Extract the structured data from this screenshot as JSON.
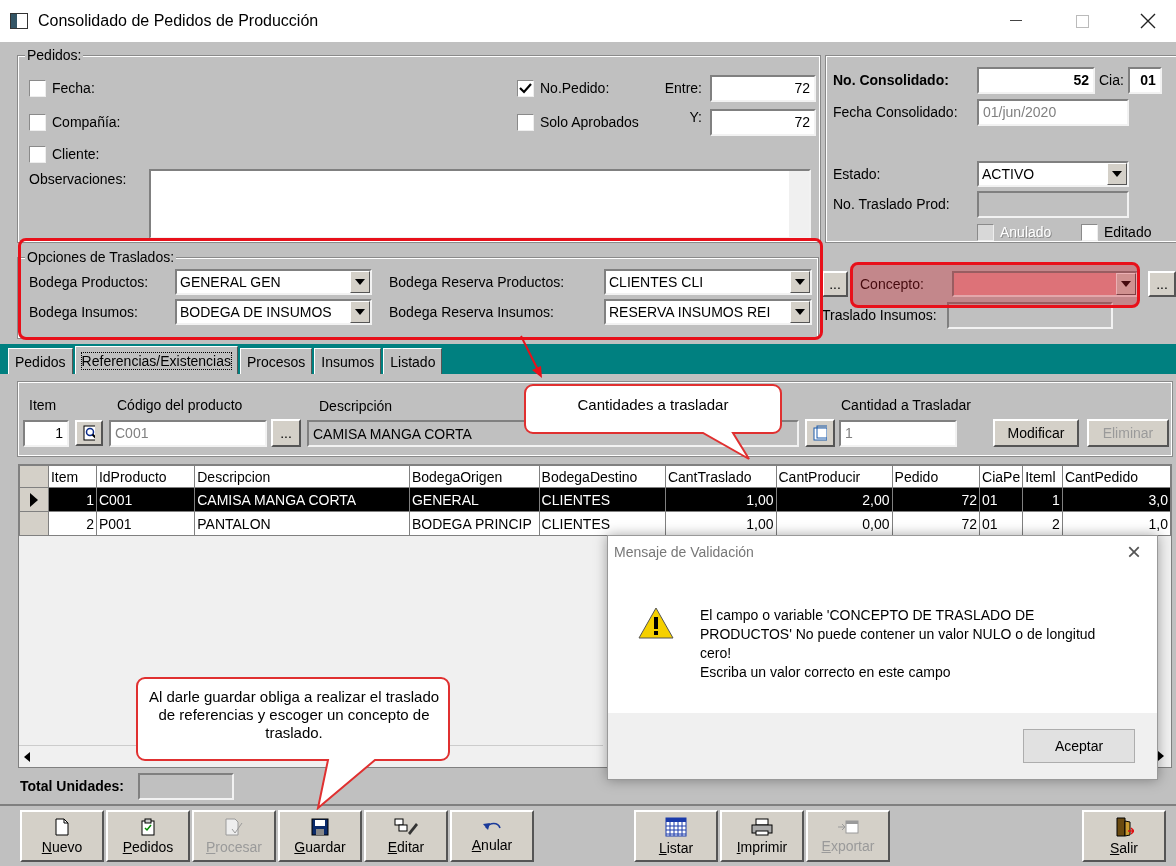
{
  "window": {
    "title": "Consolidado de Pedidos de Producción"
  },
  "pedidos": {
    "legend": "Pedidos:",
    "filters": [
      {
        "label": "Fecha:",
        "checked": false
      },
      {
        "label": "Compañía:",
        "checked": false
      },
      {
        "label": "Cliente:",
        "checked": false
      }
    ],
    "options": [
      {
        "label": "No.Pedido:",
        "checked": true
      },
      {
        "label": "Solo Aprobados",
        "checked": false
      }
    ],
    "range": [
      {
        "label": "Entre:",
        "value": "72"
      },
      {
        "label": "Y:",
        "value": "72"
      }
    ],
    "observaciones": {
      "label": "Observaciones:"
    }
  },
  "consolidado": {
    "number": {
      "label": "No. Consolidado:",
      "value": "52"
    },
    "cia": {
      "label": "Cia:",
      "value": "01"
    },
    "fecha": {
      "label": "Fecha Consolidado:",
      "value": "01/jun/2020"
    },
    "estado": {
      "label": "Estado:",
      "value": "ACTIVO"
    },
    "traslado_prod": {
      "label": "No. Traslado Prod:"
    },
    "flags": [
      {
        "label": "Anulado",
        "checked": false,
        "disabled": true
      },
      {
        "label": "Editado",
        "checked": false,
        "disabled": false
      }
    ]
  },
  "opciones": {
    "legend": "Opciones de Traslados:",
    "bodegas": [
      {
        "label": "Bodega Productos:",
        "value": "GENERAL GEN"
      },
      {
        "label": "Bodega Reserva Productos:",
        "value": "CLIENTES CLI"
      },
      {
        "label": "Bodega Insumos:",
        "value": "BODEGA DE INSUMOS"
      },
      {
        "label": "Bodega Reserva Insumos:",
        "value": "RESERVA INSUMOS REI"
      }
    ],
    "more_buttons": [
      "...",
      "..."
    ],
    "concepto": {
      "label": "Concepto:"
    },
    "traslado_insumos": {
      "label": "Traslado Insumos:"
    }
  },
  "tabs": [
    {
      "label": "Pedidos",
      "selected": false
    },
    {
      "label": "Referencias/Existencias",
      "selected": true
    },
    {
      "label": "Procesos",
      "selected": false
    },
    {
      "label": "Insumos",
      "selected": false
    },
    {
      "label": "Listado",
      "selected": false
    }
  ],
  "entry": {
    "item": {
      "label": "Item",
      "value": "1"
    },
    "codigo": {
      "label": "Código del producto",
      "value": "C001"
    },
    "browse": "...",
    "descripcion": {
      "label": "Descripción",
      "value": "CAMISA MANGA CORTA"
    },
    "cantidad": {
      "label": "Cantidad a Trasladar",
      "value": "1"
    },
    "buttons": [
      {
        "label": "Modificar",
        "disabled": false
      },
      {
        "label": "Eliminar",
        "disabled": true
      }
    ]
  },
  "table": {
    "columns": [
      "Item",
      "IdProducto",
      "Descripcion",
      "BodegaOrigen",
      "BodegaDestino",
      "CantTraslado",
      "CantProducir",
      "Pedido",
      "CiaPe",
      "Iteml",
      "CantPedido"
    ],
    "rows": [
      {
        "selected": true,
        "cells": [
          "1",
          "C001",
          "CAMISA MANGA CORTA",
          "GENERAL",
          "CLIENTES",
          "1,00",
          "2,00",
          "72",
          "01",
          "1",
          "3,0"
        ]
      },
      {
        "selected": false,
        "cells": [
          "2",
          "P001",
          "PANTALON",
          "BODEGA PRINCIP",
          "CLIENTES",
          "1,00",
          "0,00",
          "72",
          "01",
          "2",
          "1,0"
        ]
      }
    ]
  },
  "total": {
    "label": "Total Unidades:"
  },
  "toolbar": [
    [
      {
        "label": "Nuevo",
        "kind": "new",
        "disabled": false
      },
      {
        "label": "Pedidos",
        "kind": "clipboard",
        "disabled": false
      },
      {
        "label": "Procesar",
        "kind": "process",
        "disabled": true
      },
      {
        "label": "Guardar",
        "kind": "save",
        "disabled": false
      },
      {
        "label": "Editar",
        "kind": "edit",
        "disabled": false
      },
      {
        "label": "Anular",
        "kind": "undo",
        "disabled": false
      }
    ],
    [
      {
        "label": "Listar",
        "kind": "calendar",
        "disabled": false
      },
      {
        "label": "Imprimir",
        "kind": "print",
        "disabled": false
      },
      {
        "label": "Exportar",
        "kind": "export",
        "disabled": true
      }
    ],
    [
      {
        "label": "Salir",
        "kind": "exit",
        "disabled": false
      }
    ]
  ],
  "callouts": [
    {
      "text": "Cantidades a trasladar"
    },
    {
      "text": "Al darle guardar obliga a realizar el traslado de referencias y escoger un concepto de traslado."
    }
  ],
  "dialog": {
    "title": "Mensaje de Validación",
    "close": "×",
    "message": [
      "El campo o variable 'CONCEPTO DE TRASLADO DE PRODUCTOS' No puede contener un valor NULO o de longitud cero!",
      "Escriba un valor correcto en este campo"
    ],
    "button": "Aceptar"
  }
}
